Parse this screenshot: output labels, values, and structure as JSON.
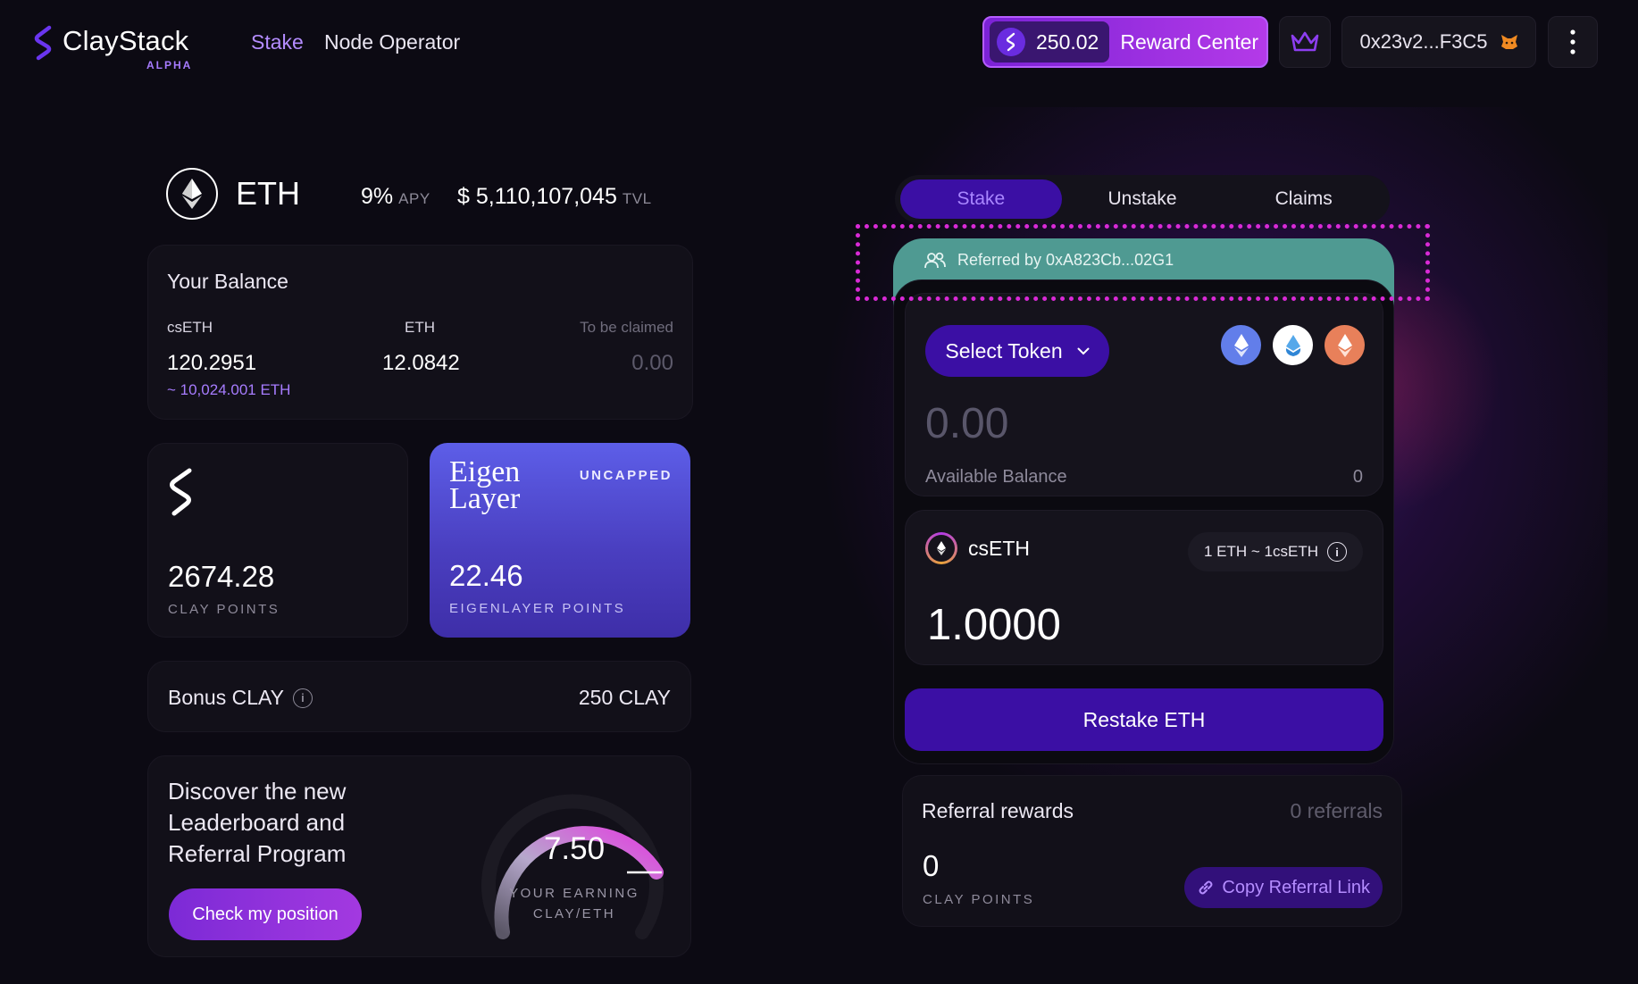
{
  "app": {
    "brand": "ClayStack",
    "brand_sub": "ALPHA",
    "accent": "#7b22d6"
  },
  "nav": {
    "stake": "Stake",
    "node_operator": "Node Operator"
  },
  "header": {
    "reward_amount": "250.02",
    "reward_center": "Reward Center",
    "wallet_address": "0x23v2...F3C5"
  },
  "asset": {
    "name": "ETH",
    "apy_value": "9%",
    "apy_label": "APY",
    "tvl_value": "$ 5,110,107,045",
    "tvl_label": "TVL"
  },
  "balance": {
    "title": "Your Balance",
    "cseth_label": "csETH",
    "eth_label": "ETH",
    "claim_label": "To be claimed",
    "cseth_value": "120.2951",
    "eth_value": "12.0842",
    "claim_value": "0.00",
    "cseth_equiv": "~ 10,024.001 ETH"
  },
  "points": {
    "clay_value": "2674.28",
    "clay_label": "CLAY POINTS",
    "eigen_logo_line1": "Eigen",
    "eigen_logo_line2": "Layer",
    "eigen_badge": "UNCAPPED",
    "eigen_value": "22.46",
    "eigen_label": "EIGENLAYER POINTS"
  },
  "bonus": {
    "label": "Bonus CLAY",
    "value": "250 CLAY"
  },
  "promo": {
    "text": "Discover the new Leaderboard and Referral Program",
    "button": "Check my position",
    "gauge_value": "7.50",
    "gauge_label_1": "YOUR EARNING",
    "gauge_label_2": "CLAY/ETH"
  },
  "stake_tabs": [
    "Stake",
    "Unstake",
    "Claims"
  ],
  "referral_banner": "Referred by 0xA823Cb...02G1",
  "stake_form": {
    "select_token": "Select Token",
    "amount_placeholder": "0.00",
    "available_label": "Available Balance",
    "available_value": "0",
    "output_token": "csETH",
    "rate": "1 ETH ~ 1csETH",
    "output_value": "1.0000",
    "submit": "Restake ETH"
  },
  "referral_rewards": {
    "title": "Referral rewards",
    "count": "0 referrals",
    "value": "0",
    "label": "CLAY POINTS",
    "copy_button": "Copy Referral Link"
  }
}
